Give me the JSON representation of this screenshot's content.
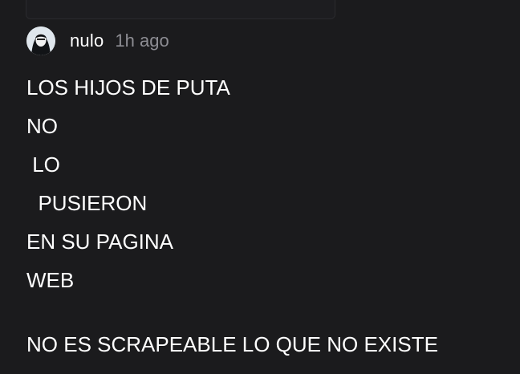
{
  "comment": {
    "author": "nulo",
    "time": "1h ago",
    "lines": [
      "LOS HIJOS DE PUTA",
      "NO",
      " LO",
      "  PUSIERON",
      "EN SU PAGINA",
      "WEB"
    ],
    "closing": "NO ES SCRAPEABLE LO QUE NO EXISTE"
  },
  "colors": {
    "background": "#1b1b1d",
    "text": "#ffffff",
    "muted": "#8d8d93"
  },
  "icons": {
    "avatar": "user-avatar-icon"
  }
}
